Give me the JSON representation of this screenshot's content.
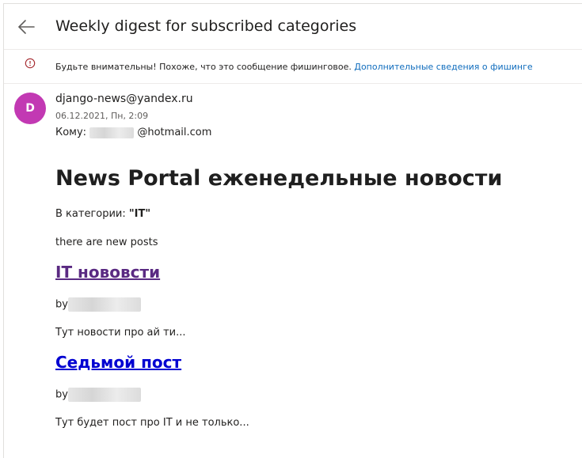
{
  "email": {
    "subject": "Weekly digest for subscribed categories",
    "phishing": {
      "text": "Будьте внимательны! Похоже, что это сообщение фишинговое.",
      "link": "Дополнительные сведения о фишинге"
    },
    "sender": {
      "avatar_letter": "D",
      "avatar_color": "#c239b3",
      "address": "django-news@yandex.ru",
      "date": "06.12.2021, Пн, 2:09",
      "to_label": "Кому:",
      "to_domain": "@hotmail.com"
    },
    "body": {
      "heading": "News Portal еженедельные новости",
      "category_prefix": "В категории: ",
      "category": "\"IT\"",
      "intro": "there are new posts",
      "posts": [
        {
          "title": "IT нововсти",
          "by": "by",
          "excerpt": "Тут новости про ай ти..."
        },
        {
          "title": "Седьмой пост",
          "by": "by",
          "excerpt": "Тут будет пост про IT и не только..."
        }
      ]
    }
  }
}
